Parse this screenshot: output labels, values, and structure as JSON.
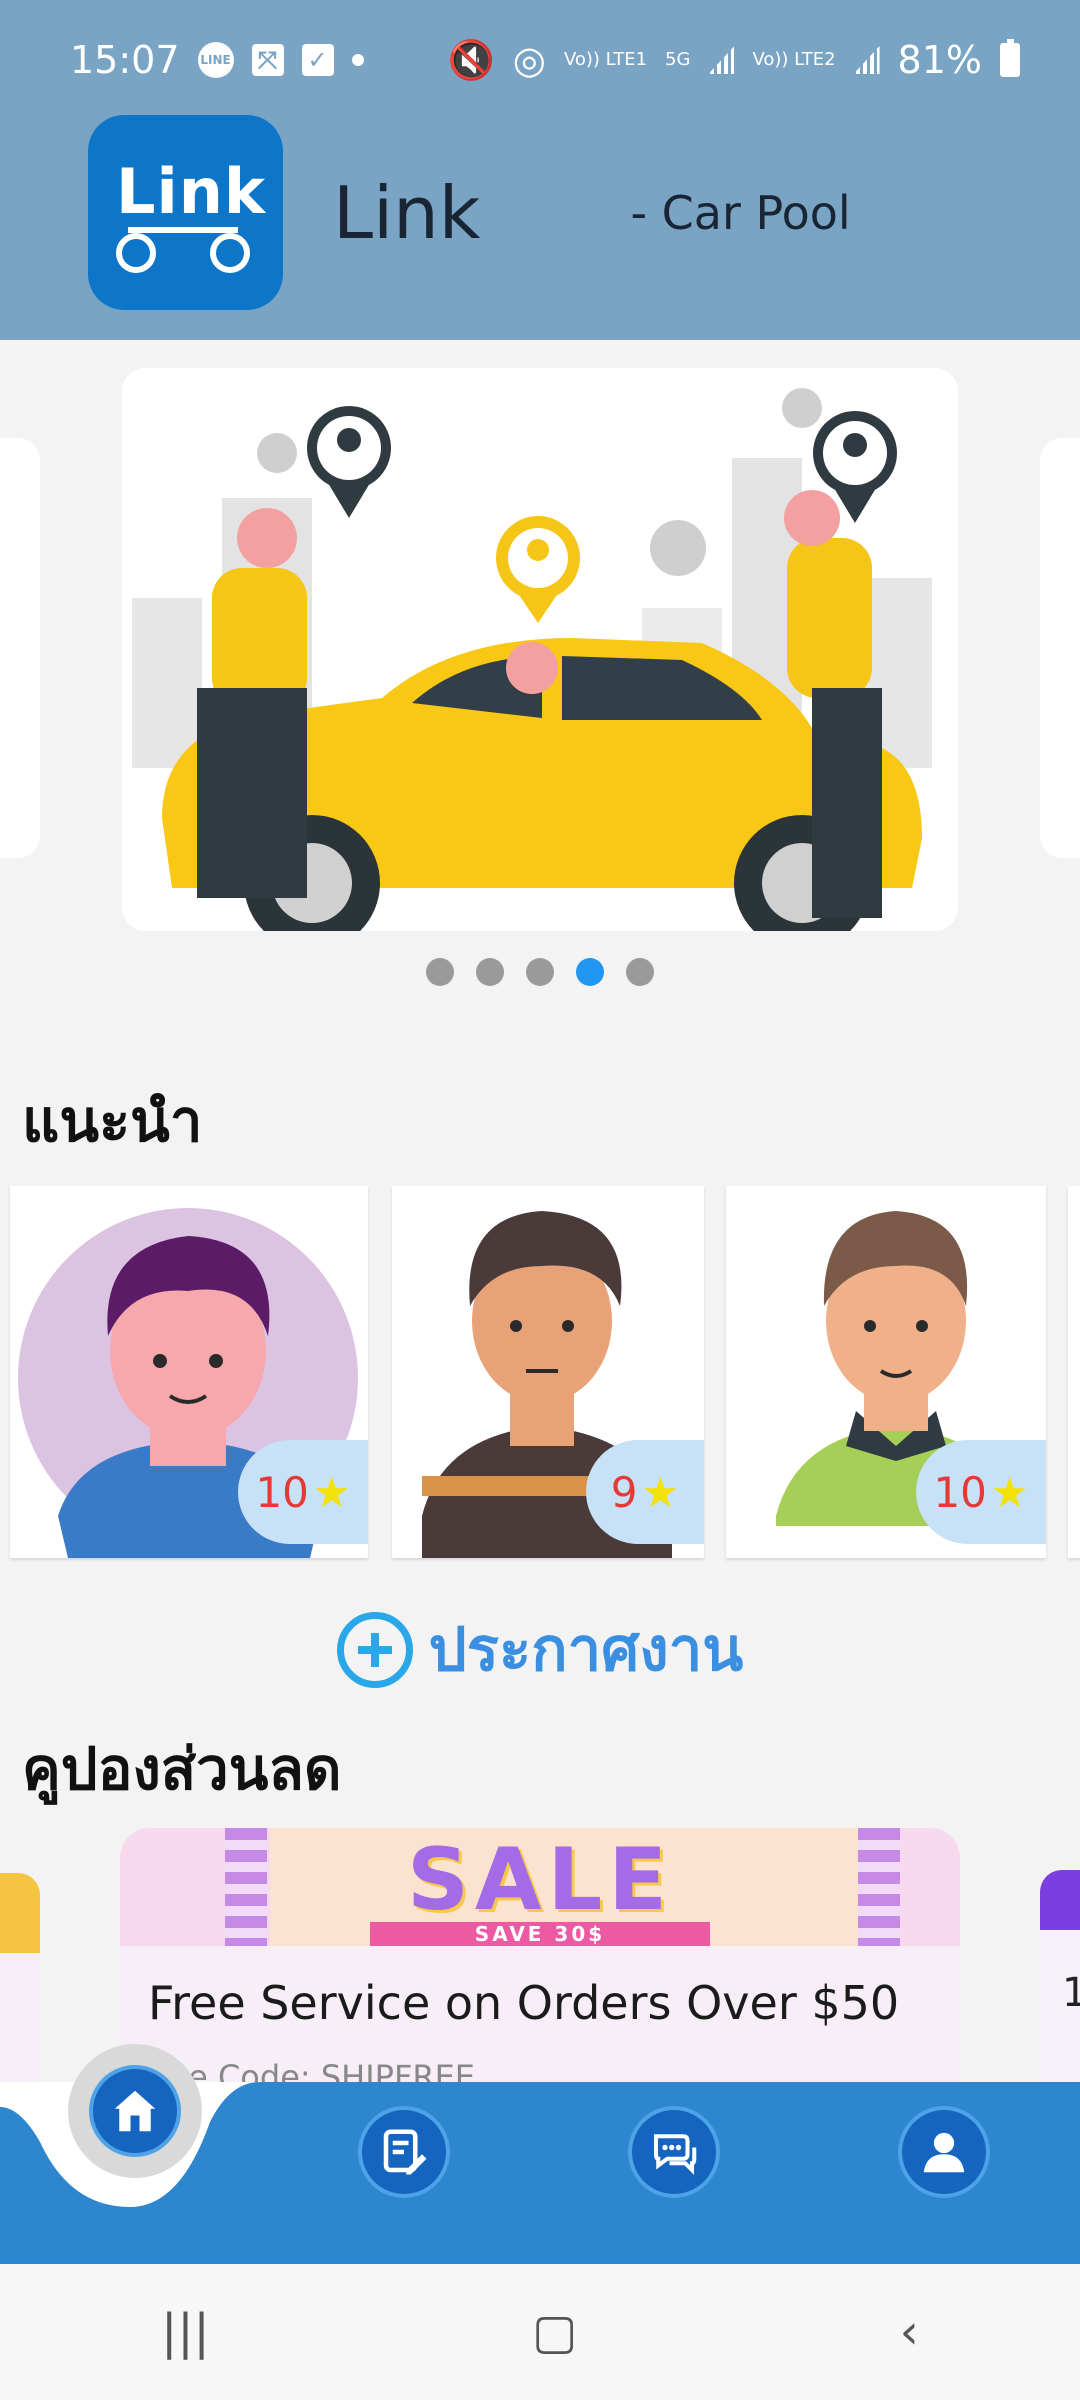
{
  "status_bar": {
    "time": "15:07",
    "line_badge": "LINE",
    "volte1": "Vo)) LTE1",
    "network": "5G",
    "volte2": "Vo)) LTE2",
    "battery": "81%"
  },
  "header": {
    "logo_text": "Link",
    "app_name": "Link",
    "subtitle": "- Car Pool"
  },
  "carousel": {
    "slide_count": 5,
    "active_index": 3
  },
  "recommend": {
    "title": "แนะนำ",
    "drivers": [
      {
        "rating": "10",
        "avatar": "driver-avatar-icon"
      },
      {
        "rating": "9",
        "avatar": "driver-avatar-icon"
      },
      {
        "rating": "10",
        "avatar": "driver-avatar-icon"
      }
    ]
  },
  "post_job": {
    "label": "ประกาศงาน"
  },
  "coupons": {
    "title": "คูปองส่วนลด",
    "items": [
      {
        "banner": "SALE",
        "banner_sub": "SAVE 30$",
        "title": "Free Service on Orders Over $50",
        "code": "Use Code: SHIPFREE"
      }
    ],
    "next_peek": "1"
  },
  "bottom_nav": {
    "items": [
      "home-icon",
      "edit-document-icon",
      "chat-icon",
      "profile-icon"
    ]
  },
  "colors": {
    "header_bg": "#7aa4c4",
    "logo_bg": "#0e76c8",
    "nav_bg": "#2e86cf",
    "accent": "#2196f3",
    "rating_text": "#e53935"
  }
}
